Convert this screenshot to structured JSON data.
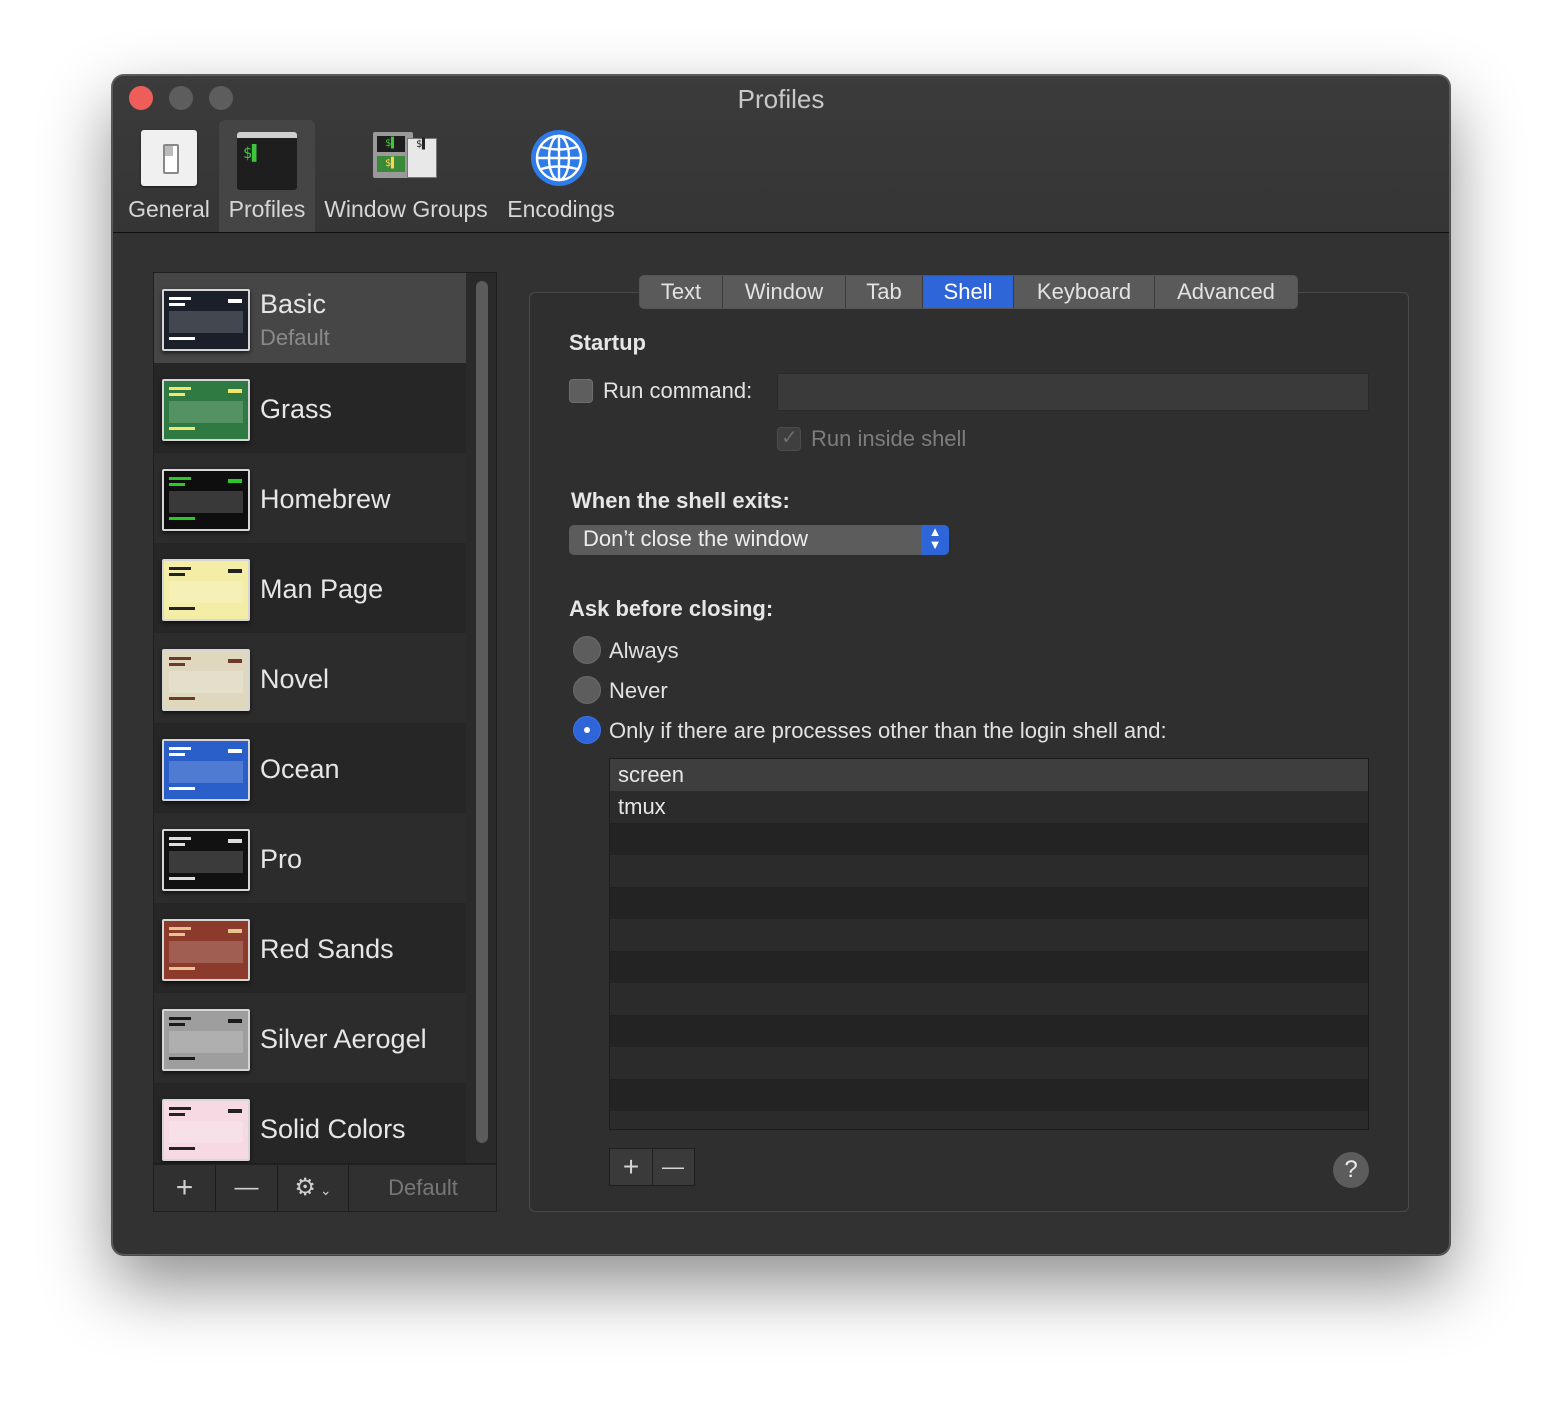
{
  "window": {
    "title": "Profiles"
  },
  "toolbar": {
    "items": [
      {
        "label": "General",
        "icon": "general-switch-icon"
      },
      {
        "label": "Profiles",
        "icon": "terminal-icon",
        "selected": true
      },
      {
        "label": "Window Groups",
        "icon": "window-groups-icon"
      },
      {
        "label": "Encodings",
        "icon": "globe-icon"
      }
    ]
  },
  "profiles": {
    "items": [
      {
        "name": "Basic",
        "sub": "Default",
        "selected": true,
        "thumb_bg": "#1a1f2a",
        "thumb_fg": "#ffffff"
      },
      {
        "name": "Grass",
        "thumb_bg": "#2f7a43",
        "thumb_fg": "#f4e56b"
      },
      {
        "name": "Homebrew",
        "thumb_bg": "#0e0e0e",
        "thumb_fg": "#28c928"
      },
      {
        "name": "Man Page",
        "thumb_bg": "#f3eda5",
        "thumb_fg": "#222222"
      },
      {
        "name": "Novel",
        "thumb_bg": "#dfd8bf",
        "thumb_fg": "#6b3a2a"
      },
      {
        "name": "Ocean",
        "thumb_bg": "#2a5fc9",
        "thumb_fg": "#ffffff"
      },
      {
        "name": "Pro",
        "thumb_bg": "#111111",
        "thumb_fg": "#dddddd"
      },
      {
        "name": "Red Sands",
        "thumb_bg": "#8b3a2b",
        "thumb_fg": "#e6c48f"
      },
      {
        "name": "Silver Aerogel",
        "thumb_bg": "#9e9e9e",
        "thumb_fg": "#1a1a1a"
      },
      {
        "name": "Solid Colors",
        "thumb_bg": "#f6d9e2",
        "thumb_fg": "#222222"
      }
    ],
    "toolbar": {
      "add": "+",
      "remove": "—",
      "gear": "⚙",
      "default_label": "Default"
    }
  },
  "tabs": {
    "items": [
      "Text",
      "Window",
      "Tab",
      "Shell",
      "Keyboard",
      "Advanced"
    ],
    "active": "Shell"
  },
  "shell": {
    "startup_heading": "Startup",
    "run_command_label": "Run command:",
    "run_command_value": "",
    "run_inside_shell_label": "Run inside shell",
    "exit_heading": "When the shell exits:",
    "exit_option": "Don’t close the window",
    "ask_heading": "Ask before closing:",
    "ask_options": [
      "Always",
      "Never",
      "Only if there are processes other than the login shell and:"
    ],
    "ask_selected": 2,
    "processes": [
      "screen",
      "tmux"
    ],
    "add_label": "+",
    "remove_label": "—",
    "help_label": "?"
  },
  "colors": {
    "accent": "#2e65d8",
    "close": "#ed5e5a"
  }
}
